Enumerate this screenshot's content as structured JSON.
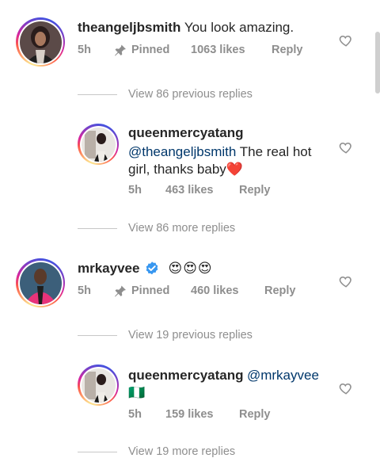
{
  "colors": {
    "mention": "#00376b",
    "muted": "#8e8e8e",
    "text": "#262626",
    "verified": "#3897f0",
    "heart_red": "#e0245e"
  },
  "comments": [
    {
      "username": "theangeljbsmith",
      "text": "You look amazing.",
      "time": "5h",
      "pinned_label": "Pinned",
      "likes": "1063 likes",
      "reply_label": "Reply",
      "view_previous": "View 86 previous replies",
      "reply": {
        "username": "queenmercyatang",
        "mention": "@theangeljbsmith",
        "text_line1": " The real hot",
        "text_line2": "girl, thanks baby",
        "emoji": "❤️",
        "time": "5h",
        "likes": "463 likes",
        "reply_label": "Reply"
      },
      "view_more": "View 86 more replies"
    },
    {
      "username": "mrkayvee",
      "verified_icon": "verified-badge-icon",
      "text": "😍😍😍",
      "time": "5h",
      "pinned_label": "Pinned",
      "likes": "460 likes",
      "reply_label": "Reply",
      "view_previous": "View 19 previous replies",
      "reply": {
        "username": "queenmercyatang",
        "mention": "@mrkayvee",
        "text_line2": "🇳🇬",
        "time": "5h",
        "likes": "159 likes",
        "reply_label": "Reply"
      },
      "view_more": "View 19 more replies"
    }
  ]
}
